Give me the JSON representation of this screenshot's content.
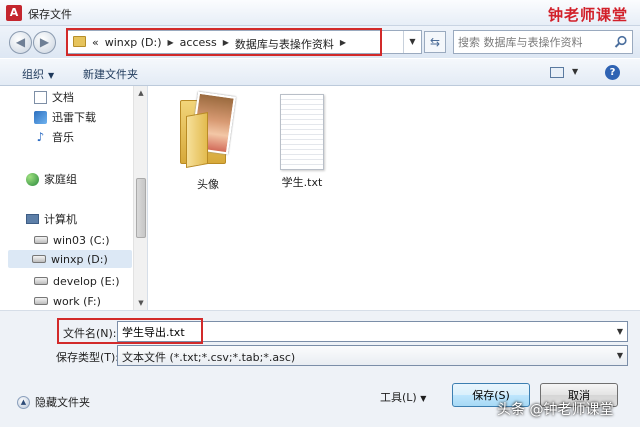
{
  "window": {
    "title": "保存文件",
    "app_icon_letter": "A",
    "watermark_top": "钟老师课堂"
  },
  "address": {
    "prefix": "«",
    "crumbs": [
      "winxp (D:)",
      "access",
      "数据库与表操作资料"
    ]
  },
  "search": {
    "placeholder": "搜索 数据库与表操作资料"
  },
  "toolbar": {
    "organize": "组织",
    "new_folder": "新建文件夹"
  },
  "sidebar": {
    "items": [
      {
        "label": "文档",
        "icon": "document-icon"
      },
      {
        "label": "迅雷下载",
        "icon": "download-icon"
      },
      {
        "label": "音乐",
        "icon": "music-icon"
      },
      {
        "label": "家庭组",
        "icon": "homegroup-icon"
      },
      {
        "label": "计算机",
        "icon": "computer-icon"
      },
      {
        "label": "win03 (C:)",
        "icon": "drive-icon"
      },
      {
        "label": "winxp (D:)",
        "icon": "drive-icon",
        "selected": true
      },
      {
        "label": "develop (E:)",
        "icon": "drive-icon"
      },
      {
        "label": "work (F:)",
        "icon": "drive-icon"
      }
    ]
  },
  "files": [
    {
      "name": "头像",
      "icon": "photo-folder-icon"
    },
    {
      "name": "学生.txt",
      "icon": "text-file-icon"
    }
  ],
  "form": {
    "filename_label": "文件名(N):",
    "filename_value": "学生导出.txt",
    "type_label": "保存类型(T):",
    "type_value": "文本文件 (*.txt;*.csv;*.tab;*.asc)"
  },
  "footer": {
    "hide_folders": "隐藏文件夹",
    "tools": "工具(L)",
    "save": "保存(S)",
    "cancel": "取消",
    "watermark": "头条 @钟老师课堂"
  },
  "colors": {
    "highlight": "#d22a2a",
    "watermark": "#d2202a",
    "selected_bg": "#dce8f5"
  }
}
